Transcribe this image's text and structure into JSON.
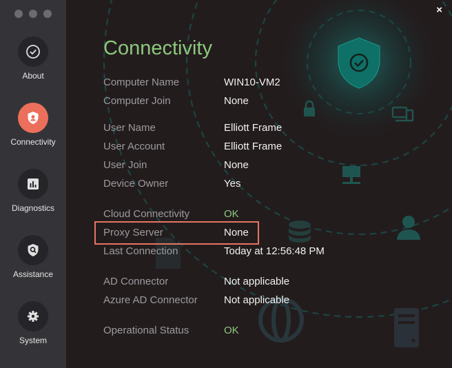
{
  "sidebar": {
    "items": [
      {
        "label": "About",
        "icon": "check-circle-icon",
        "active": false
      },
      {
        "label": "Connectivity",
        "icon": "shield-user-icon",
        "active": true
      },
      {
        "label": "Diagnostics",
        "icon": "bar-chart-icon",
        "active": false
      },
      {
        "label": "Assistance",
        "icon": "search-shield-icon",
        "active": false
      },
      {
        "label": "System",
        "icon": "gear-icon",
        "active": false
      }
    ]
  },
  "main": {
    "title": "Connectivity",
    "close_label": "×",
    "rows": [
      {
        "label": "Computer Name",
        "value": "WIN10-VM2"
      },
      {
        "label": "Computer Join",
        "value": "None"
      },
      {
        "label": "User Name",
        "value": "Elliott Frame"
      },
      {
        "label": "User Account",
        "value": "Elliott Frame"
      },
      {
        "label": "User Join",
        "value": "None"
      },
      {
        "label": "Device Owner",
        "value": "Yes"
      },
      {
        "label": "Cloud Connectivity",
        "value": "OK",
        "status": "ok"
      },
      {
        "label": "Proxy Server",
        "value": "None",
        "highlighted": true
      },
      {
        "label": "Last Connection",
        "value": "Today at 12:56:48 PM"
      },
      {
        "label": "AD Connector",
        "value": "Not applicable"
      },
      {
        "label": "Azure AD Connector",
        "value": "Not applicable"
      },
      {
        "label": "Operational Status",
        "value": "OK",
        "status": "ok"
      }
    ]
  },
  "colors": {
    "accent_green": "#8cc87d",
    "active_nav": "#ec6f5b",
    "highlight_border": "#e57662",
    "sidebar_bg": "#343438",
    "main_bg": "#231c1d"
  },
  "background_icons": [
    "shield-check-icon",
    "lock-icon",
    "devices-icon",
    "network-icon",
    "database-icon",
    "user-icon",
    "document-icon",
    "globe-icon",
    "server-icon"
  ]
}
